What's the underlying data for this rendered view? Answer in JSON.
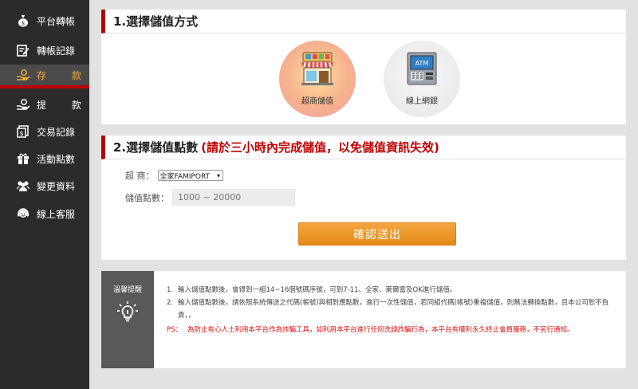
{
  "sidebar": {
    "items": [
      {
        "label": "平台轉帳",
        "icon": "money-bag-icon"
      },
      {
        "label": "轉帳記錄",
        "icon": "edit-note-icon"
      },
      {
        "label": "存 款",
        "icon": "deposit-hand-icon",
        "active": true
      },
      {
        "label": "提 款",
        "icon": "withdraw-hand-icon"
      },
      {
        "label": "交易記錄",
        "icon": "transaction-record-icon"
      },
      {
        "label": "活動點數",
        "icon": "gift-icon"
      },
      {
        "label": "變更資料",
        "icon": "users-icon"
      },
      {
        "label": "線上客服",
        "icon": "customer-service-icon"
      }
    ]
  },
  "section1": {
    "title": "1.選擇儲值方式",
    "methods": [
      {
        "label": "超商儲值",
        "icon": "convenience-store-icon"
      },
      {
        "label": "線上網銀",
        "icon": "atm-icon",
        "icon_text": "ATM"
      }
    ]
  },
  "section2": {
    "title": "2.選擇儲值點數",
    "warning": "(請於三小時內完成儲值，以免儲值資訊失效)",
    "store_label": "超 商：",
    "store_value": "全家FAMIPORT",
    "points_label": "儲值點數：",
    "points_placeholder": "1000 ~ 20000",
    "submit_label": "確認送出"
  },
  "tips": {
    "title": "溫馨提醒",
    "items": [
      "輸入儲值點數後，會得到一組14~16個號碼序號，可到7-11、全家、萊爾富及OK進行儲值。",
      "輸入儲值點數後，請依照系統傳送之代碼(帳號)與相對應點數，進行一次性儲值，若同組代碼(帳號)重複儲值，則無法轉換點數，且本公司恕不負責，，"
    ],
    "ps_label": "PS：",
    "ps_text": "為防止有心人士利用本平台作為詐騙工具，如利用本平台進行任何洗錢詐騙行為，本平台有權利永久終止會員服務，不另行通知。"
  },
  "colors": {
    "accent_red": "#b30000",
    "submit_orange": "#e8901e",
    "sidebar_bg": "#2b2b2b",
    "active_text": "#f3a93a"
  }
}
